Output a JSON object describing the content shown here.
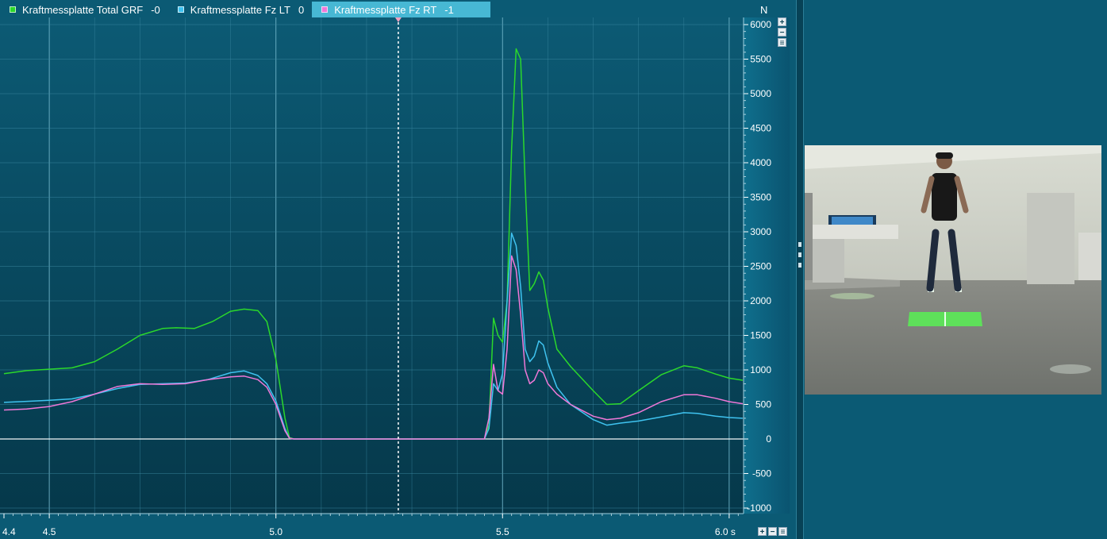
{
  "legend": {
    "items": [
      {
        "label": "Kraftmessplatte Total GRF",
        "value": "-0",
        "color": "#2bd82b",
        "active": false
      },
      {
        "label": "Kraftmessplatte Fz LT",
        "value": "0",
        "color": "#3fc3f0",
        "active": false
      },
      {
        "label": "Kraftmessplatte Fz RT",
        "value": "-1",
        "color": "#f078d8",
        "active": true
      }
    ]
  },
  "unit": "N",
  "zoom": {
    "plus": "+",
    "minus": "−",
    "fit": "≡"
  },
  "colors": {
    "background": "#0b5a74",
    "plot_top": "#0c5973",
    "plot_bottom": "#063a4c",
    "grid": "#3d8aa3",
    "cursor": "#ffffff"
  },
  "chart_data": {
    "type": "line",
    "xlabel": "",
    "ylabel": "",
    "x_unit": "s",
    "y_unit": "N",
    "xlim": [
      4.4,
      6.03
    ],
    "ylim": [
      -1000,
      6000
    ],
    "x_ticks": [
      "4.4",
      "4.5",
      "5.0",
      "5.5",
      "6.0 s"
    ],
    "x_tick_values": [
      4.4,
      4.5,
      5.0,
      5.5,
      6.0
    ],
    "y_ticks": [
      6000,
      5500,
      5000,
      4500,
      4000,
      3500,
      3000,
      2500,
      2000,
      1500,
      1000,
      500,
      0,
      -500,
      -1000
    ],
    "cursor_x": 5.27,
    "grid": true,
    "series": [
      {
        "name": "Kraftmessplatte Total GRF",
        "color": "#2bd82b",
        "points": [
          [
            4.4,
            945
          ],
          [
            4.45,
            990
          ],
          [
            4.5,
            1010
          ],
          [
            4.55,
            1030
          ],
          [
            4.6,
            1120
          ],
          [
            4.65,
            1300
          ],
          [
            4.7,
            1500
          ],
          [
            4.75,
            1600
          ],
          [
            4.78,
            1610
          ],
          [
            4.82,
            1600
          ],
          [
            4.86,
            1700
          ],
          [
            4.9,
            1850
          ],
          [
            4.93,
            1880
          ],
          [
            4.96,
            1860
          ],
          [
            4.98,
            1700
          ],
          [
            5.0,
            1150
          ],
          [
            5.02,
            300
          ],
          [
            5.03,
            20
          ],
          [
            5.04,
            0
          ],
          [
            5.1,
            0
          ],
          [
            5.2,
            0
          ],
          [
            5.3,
            0
          ],
          [
            5.4,
            0
          ],
          [
            5.46,
            0
          ],
          [
            5.47,
            200
          ],
          [
            5.48,
            1750
          ],
          [
            5.49,
            1500
          ],
          [
            5.5,
            1400
          ],
          [
            5.51,
            2000
          ],
          [
            5.52,
            4200
          ],
          [
            5.53,
            5650
          ],
          [
            5.54,
            5500
          ],
          [
            5.55,
            3700
          ],
          [
            5.56,
            2150
          ],
          [
            5.57,
            2250
          ],
          [
            5.58,
            2420
          ],
          [
            5.59,
            2300
          ],
          [
            5.6,
            1900
          ],
          [
            5.62,
            1300
          ],
          [
            5.65,
            1050
          ],
          [
            5.7,
            700
          ],
          [
            5.73,
            500
          ],
          [
            5.76,
            510
          ],
          [
            5.8,
            700
          ],
          [
            5.85,
            930
          ],
          [
            5.9,
            1060
          ],
          [
            5.93,
            1030
          ],
          [
            5.97,
            940
          ],
          [
            6.0,
            880
          ],
          [
            6.03,
            850
          ]
        ]
      },
      {
        "name": "Kraftmessplatte Fz LT",
        "color": "#3fc3f0",
        "points": [
          [
            4.4,
            530
          ],
          [
            4.45,
            545
          ],
          [
            4.5,
            560
          ],
          [
            4.55,
            580
          ],
          [
            4.6,
            650
          ],
          [
            4.65,
            730
          ],
          [
            4.7,
            790
          ],
          [
            4.75,
            800
          ],
          [
            4.8,
            810
          ],
          [
            4.85,
            860
          ],
          [
            4.9,
            960
          ],
          [
            4.93,
            985
          ],
          [
            4.96,
            920
          ],
          [
            4.98,
            800
          ],
          [
            5.0,
            550
          ],
          [
            5.02,
            150
          ],
          [
            5.03,
            10
          ],
          [
            5.04,
            0
          ],
          [
            5.2,
            0
          ],
          [
            5.46,
            0
          ],
          [
            5.47,
            150
          ],
          [
            5.48,
            800
          ],
          [
            5.49,
            700
          ],
          [
            5.5,
            950
          ],
          [
            5.51,
            2000
          ],
          [
            5.52,
            2980
          ],
          [
            5.53,
            2800
          ],
          [
            5.54,
            2200
          ],
          [
            5.55,
            1300
          ],
          [
            5.56,
            1120
          ],
          [
            5.57,
            1200
          ],
          [
            5.58,
            1420
          ],
          [
            5.59,
            1360
          ],
          [
            5.6,
            1100
          ],
          [
            5.62,
            750
          ],
          [
            5.65,
            500
          ],
          [
            5.7,
            280
          ],
          [
            5.73,
            200
          ],
          [
            5.76,
            230
          ],
          [
            5.8,
            260
          ],
          [
            5.85,
            320
          ],
          [
            5.9,
            380
          ],
          [
            5.93,
            370
          ],
          [
            5.97,
            330
          ],
          [
            6.0,
            310
          ],
          [
            6.03,
            300
          ]
        ]
      },
      {
        "name": "Kraftmessplatte Fz RT",
        "color": "#f078d8",
        "points": [
          [
            4.4,
            420
          ],
          [
            4.45,
            435
          ],
          [
            4.5,
            470
          ],
          [
            4.55,
            540
          ],
          [
            4.6,
            650
          ],
          [
            4.65,
            760
          ],
          [
            4.7,
            800
          ],
          [
            4.75,
            790
          ],
          [
            4.8,
            800
          ],
          [
            4.85,
            860
          ],
          [
            4.9,
            900
          ],
          [
            4.93,
            910
          ],
          [
            4.96,
            860
          ],
          [
            4.98,
            750
          ],
          [
            5.0,
            500
          ],
          [
            5.02,
            120
          ],
          [
            5.03,
            10
          ],
          [
            5.04,
            0
          ],
          [
            5.2,
            0
          ],
          [
            5.46,
            0
          ],
          [
            5.47,
            300
          ],
          [
            5.48,
            1080
          ],
          [
            5.49,
            700
          ],
          [
            5.5,
            650
          ],
          [
            5.51,
            1300
          ],
          [
            5.52,
            2650
          ],
          [
            5.53,
            2450
          ],
          [
            5.54,
            1800
          ],
          [
            5.55,
            1000
          ],
          [
            5.56,
            800
          ],
          [
            5.57,
            850
          ],
          [
            5.58,
            1000
          ],
          [
            5.59,
            960
          ],
          [
            5.6,
            800
          ],
          [
            5.62,
            650
          ],
          [
            5.65,
            500
          ],
          [
            5.7,
            330
          ],
          [
            5.73,
            280
          ],
          [
            5.76,
            300
          ],
          [
            5.8,
            380
          ],
          [
            5.85,
            540
          ],
          [
            5.9,
            640
          ],
          [
            5.93,
            640
          ],
          [
            5.97,
            590
          ],
          [
            6.0,
            540
          ],
          [
            6.03,
            510
          ]
        ]
      }
    ]
  }
}
